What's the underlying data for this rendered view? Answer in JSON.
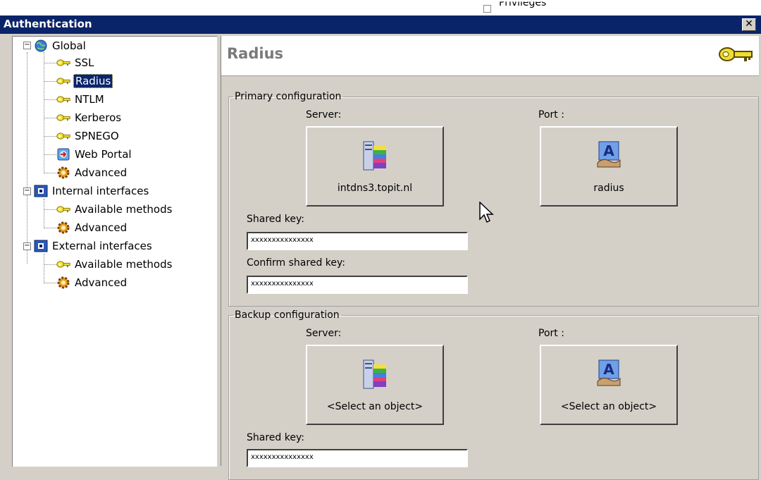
{
  "background": {
    "partial_label": "Privileges"
  },
  "window": {
    "title": "Authentication",
    "close_symbol": "✕"
  },
  "tree": {
    "nodes": [
      {
        "label": "Global",
        "icon": "globe-icon"
      },
      {
        "label": "SSL",
        "icon": "key-icon"
      },
      {
        "label": "Radius",
        "icon": "key-icon",
        "selected": true
      },
      {
        "label": "NTLM",
        "icon": "key-icon"
      },
      {
        "label": "Kerberos",
        "icon": "key-icon"
      },
      {
        "label": "SPNEGO",
        "icon": "key-icon"
      },
      {
        "label": "Web Portal",
        "icon": "web-portal-icon"
      },
      {
        "label": "Advanced",
        "icon": "gear-icon"
      },
      {
        "label": "Internal interfaces",
        "icon": "interface-icon"
      },
      {
        "label": "Available methods",
        "icon": "key-icon"
      },
      {
        "label": "Advanced",
        "icon": "gear-icon"
      },
      {
        "label": "External interfaces",
        "icon": "interface-icon"
      },
      {
        "label": "Available methods",
        "icon": "key-icon"
      },
      {
        "label": "Advanced",
        "icon": "gear-icon"
      }
    ],
    "expand_symbol": "−"
  },
  "content": {
    "title": "Radius",
    "primary": {
      "legend": "Primary configuration",
      "server_label": "Server:",
      "server_value": "intdns3.topit.nl",
      "port_label": "Port :",
      "port_value": "radius",
      "shared_key_label": "Shared key:",
      "shared_key_value": "xxxxxxxxxxxxxxx",
      "confirm_label": "Confirm shared key:",
      "confirm_value": "xxxxxxxxxxxxxxx"
    },
    "backup": {
      "legend": "Backup configuration",
      "server_label": "Server:",
      "server_value": "<Select an object>",
      "port_label": "Port :",
      "port_value": "<Select an object>",
      "shared_key_label": "Shared key:",
      "shared_key_value": "xxxxxxxxxxxxxxx"
    }
  },
  "colors": {
    "title_bar": "#0a246a",
    "key": "#e8d000",
    "selection": "#0a246a"
  }
}
